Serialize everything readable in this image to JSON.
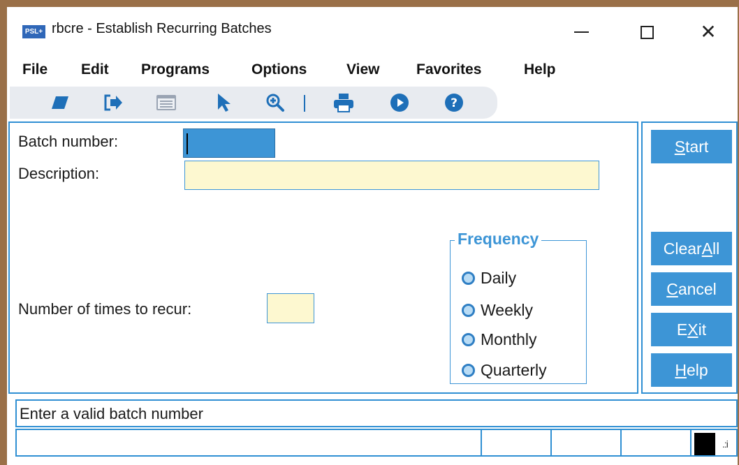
{
  "window": {
    "logo_text": "PSL+",
    "title": "rbcre - Establish Recurring Batches",
    "controls": {
      "minimize": "—",
      "maximize": "□",
      "close": "✕"
    }
  },
  "menu": [
    "File",
    "Edit",
    "Programs",
    "Options",
    "View",
    "Favorites",
    "Help"
  ],
  "toolbar": {
    "icons": [
      "eraser-icon",
      "exit-arrow-icon",
      "list-window-icon",
      "pointer-icon",
      "zoom-in-icon",
      "printer-icon",
      "play-icon",
      "help-icon"
    ],
    "icon_color": "#1e6fb8"
  },
  "form": {
    "batch_number_label": "Batch number:",
    "batch_number_value": "",
    "description_label": "Description:",
    "description_value": "",
    "recur_label": "Number of times to recur:",
    "recur_value": ""
  },
  "frequency": {
    "title": "Frequency",
    "options": [
      "Daily",
      "Weekly",
      "Monthly",
      "Quarterly"
    ]
  },
  "actions": {
    "start": {
      "pre": "",
      "u": "S",
      "post": "tart"
    },
    "clear_all": {
      "pre": "Clear ",
      "u": "A",
      "post": "ll"
    },
    "cancel": {
      "pre": "",
      "u": "C",
      "post": "ancel"
    },
    "exit": {
      "pre": "E",
      "u": "X",
      "post": "it"
    },
    "help": {
      "pre": "",
      "u": "H",
      "post": "elp"
    }
  },
  "status": {
    "message": "Enter a valid batch number",
    "grip": ".:i"
  },
  "colors": {
    "accent": "#3d95d6",
    "field_bg": "#fdf8d0",
    "frame_border": "#9a7048"
  }
}
